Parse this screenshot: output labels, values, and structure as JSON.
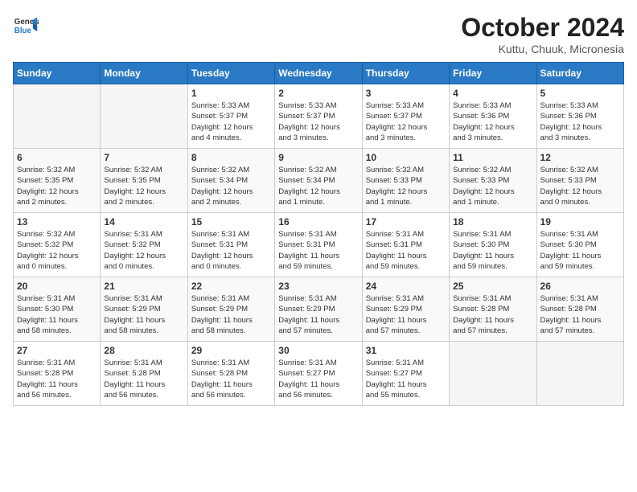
{
  "header": {
    "logo_line1": "General",
    "logo_line2": "Blue",
    "month": "October 2024",
    "location": "Kuttu, Chuuk, Micronesia"
  },
  "weekdays": [
    "Sunday",
    "Monday",
    "Tuesday",
    "Wednesday",
    "Thursday",
    "Friday",
    "Saturday"
  ],
  "weeks": [
    [
      {
        "day": "",
        "info": ""
      },
      {
        "day": "",
        "info": ""
      },
      {
        "day": "1",
        "info": "Sunrise: 5:33 AM\nSunset: 5:37 PM\nDaylight: 12 hours\nand 4 minutes."
      },
      {
        "day": "2",
        "info": "Sunrise: 5:33 AM\nSunset: 5:37 PM\nDaylight: 12 hours\nand 3 minutes."
      },
      {
        "day": "3",
        "info": "Sunrise: 5:33 AM\nSunset: 5:37 PM\nDaylight: 12 hours\nand 3 minutes."
      },
      {
        "day": "4",
        "info": "Sunrise: 5:33 AM\nSunset: 5:36 PM\nDaylight: 12 hours\nand 3 minutes."
      },
      {
        "day": "5",
        "info": "Sunrise: 5:33 AM\nSunset: 5:36 PM\nDaylight: 12 hours\nand 3 minutes."
      }
    ],
    [
      {
        "day": "6",
        "info": "Sunrise: 5:32 AM\nSunset: 5:35 PM\nDaylight: 12 hours\nand 2 minutes."
      },
      {
        "day": "7",
        "info": "Sunrise: 5:32 AM\nSunset: 5:35 PM\nDaylight: 12 hours\nand 2 minutes."
      },
      {
        "day": "8",
        "info": "Sunrise: 5:32 AM\nSunset: 5:34 PM\nDaylight: 12 hours\nand 2 minutes."
      },
      {
        "day": "9",
        "info": "Sunrise: 5:32 AM\nSunset: 5:34 PM\nDaylight: 12 hours\nand 1 minute."
      },
      {
        "day": "10",
        "info": "Sunrise: 5:32 AM\nSunset: 5:33 PM\nDaylight: 12 hours\nand 1 minute."
      },
      {
        "day": "11",
        "info": "Sunrise: 5:32 AM\nSunset: 5:33 PM\nDaylight: 12 hours\nand 1 minute."
      },
      {
        "day": "12",
        "info": "Sunrise: 5:32 AM\nSunset: 5:33 PM\nDaylight: 12 hours\nand 0 minutes."
      }
    ],
    [
      {
        "day": "13",
        "info": "Sunrise: 5:32 AM\nSunset: 5:32 PM\nDaylight: 12 hours\nand 0 minutes."
      },
      {
        "day": "14",
        "info": "Sunrise: 5:31 AM\nSunset: 5:32 PM\nDaylight: 12 hours\nand 0 minutes."
      },
      {
        "day": "15",
        "info": "Sunrise: 5:31 AM\nSunset: 5:31 PM\nDaylight: 12 hours\nand 0 minutes."
      },
      {
        "day": "16",
        "info": "Sunrise: 5:31 AM\nSunset: 5:31 PM\nDaylight: 11 hours\nand 59 minutes."
      },
      {
        "day": "17",
        "info": "Sunrise: 5:31 AM\nSunset: 5:31 PM\nDaylight: 11 hours\nand 59 minutes."
      },
      {
        "day": "18",
        "info": "Sunrise: 5:31 AM\nSunset: 5:30 PM\nDaylight: 11 hours\nand 59 minutes."
      },
      {
        "day": "19",
        "info": "Sunrise: 5:31 AM\nSunset: 5:30 PM\nDaylight: 11 hours\nand 59 minutes."
      }
    ],
    [
      {
        "day": "20",
        "info": "Sunrise: 5:31 AM\nSunset: 5:30 PM\nDaylight: 11 hours\nand 58 minutes."
      },
      {
        "day": "21",
        "info": "Sunrise: 5:31 AM\nSunset: 5:29 PM\nDaylight: 11 hours\nand 58 minutes."
      },
      {
        "day": "22",
        "info": "Sunrise: 5:31 AM\nSunset: 5:29 PM\nDaylight: 11 hours\nand 58 minutes."
      },
      {
        "day": "23",
        "info": "Sunrise: 5:31 AM\nSunset: 5:29 PM\nDaylight: 11 hours\nand 57 minutes."
      },
      {
        "day": "24",
        "info": "Sunrise: 5:31 AM\nSunset: 5:29 PM\nDaylight: 11 hours\nand 57 minutes."
      },
      {
        "day": "25",
        "info": "Sunrise: 5:31 AM\nSunset: 5:28 PM\nDaylight: 11 hours\nand 57 minutes."
      },
      {
        "day": "26",
        "info": "Sunrise: 5:31 AM\nSunset: 5:28 PM\nDaylight: 11 hours\nand 57 minutes."
      }
    ],
    [
      {
        "day": "27",
        "info": "Sunrise: 5:31 AM\nSunset: 5:28 PM\nDaylight: 11 hours\nand 56 minutes."
      },
      {
        "day": "28",
        "info": "Sunrise: 5:31 AM\nSunset: 5:28 PM\nDaylight: 11 hours\nand 56 minutes."
      },
      {
        "day": "29",
        "info": "Sunrise: 5:31 AM\nSunset: 5:28 PM\nDaylight: 11 hours\nand 56 minutes."
      },
      {
        "day": "30",
        "info": "Sunrise: 5:31 AM\nSunset: 5:27 PM\nDaylight: 11 hours\nand 56 minutes."
      },
      {
        "day": "31",
        "info": "Sunrise: 5:31 AM\nSunset: 5:27 PM\nDaylight: 11 hours\nand 55 minutes."
      },
      {
        "day": "",
        "info": ""
      },
      {
        "day": "",
        "info": ""
      }
    ]
  ]
}
